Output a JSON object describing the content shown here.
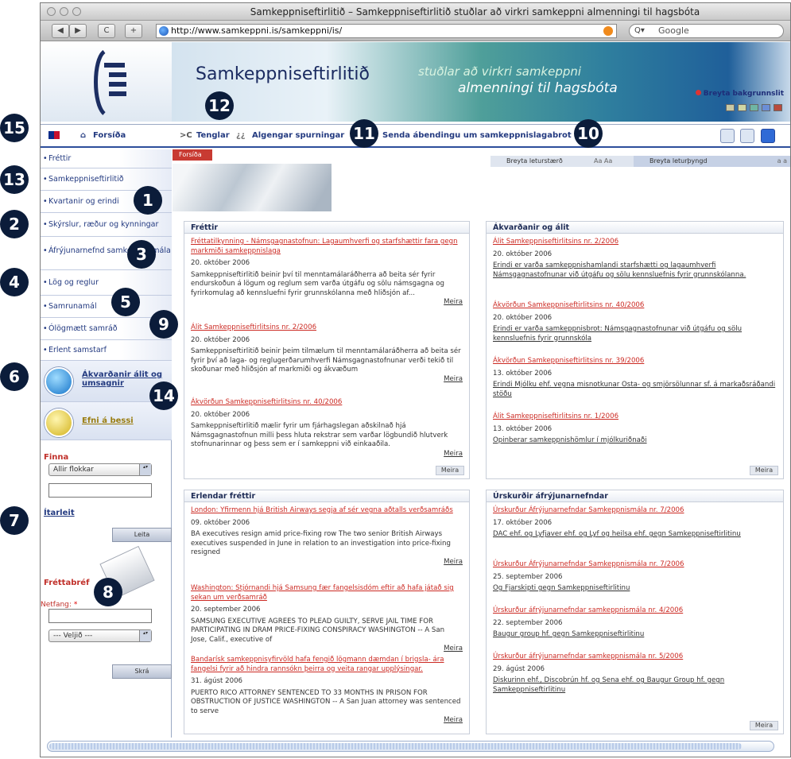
{
  "window": {
    "title": "Samkeppniseftirlitið – Samkeppniseftirlitið stuðlar að virkri samkeppni almenningi til hagsbóta"
  },
  "toolbar": {
    "back": "◀",
    "forward": "▶",
    "reload": "C",
    "add": "+",
    "url": "http://www.samkeppni.is/samkeppni/is/",
    "search_placeholder": "Google",
    "search_prefix": "Q▾"
  },
  "header": {
    "site_name": "Samkeppniseftirlitið",
    "tagline_1": "stuðlar að virkri samkeppni",
    "tagline_2": "almenningi til hagsbóta",
    "bg_change": "Breyta bakgrunnslit",
    "swatch_colors": [
      "#c9c9a4",
      "#cfd6a4",
      "#6fb5a3",
      "#6b8ed6",
      "#b94a3c"
    ]
  },
  "nav": {
    "home": "Forsíða",
    "links": "Tenglar",
    "faq": "Algengar spurningar",
    "report": "Senda ábendingu um samkeppnislagabrot"
  },
  "sidebar": {
    "items": [
      "Fréttir",
      "Samkeppniseftirlitið",
      "Kvartanir og erindi",
      "Skýrslur, ræður og kynningar",
      "Áfrýjunarnefnd samkeppnismála",
      "Lög og reglur",
      "Samrunamál",
      "Ólögmætt samráð",
      "Erlent samstarf"
    ],
    "promo_1": "Ákvarðanir álit og umsagnir",
    "promo_2": "Efni á bessi",
    "search_label": "Finna",
    "search_select": "Allir flokkar",
    "advanced": "Ítarleit",
    "search_button": "Leita",
    "newsletter_label": "Fréttabréf",
    "email_label": "Netfang:",
    "email_required": "*",
    "newsletter_select": "--- Veljið ---",
    "send_button": "Skrá"
  },
  "main": {
    "breadcrumb": "Forsíða",
    "ctrl_1": "Breyta leturstærð",
    "ctrl_1b": "Aa Aa",
    "ctrl_2": "Breyta leturþyngd",
    "ctrl_2b": "a a",
    "news": {
      "heading": "Fréttir",
      "entries": [
        {
          "title": "Fréttatilkynning - Námsgagnastofnun: Lagaumhverfi og starfshættir fara gegn markmiði samkeppnislaga",
          "date": "20. október 2006",
          "text": "Samkeppniseftirlitið beinir því til menntamálaráðherra að beita sér fyrir endurskoðun á lögum og reglum sem varða útgáfu og sölu námsgagna og fyrirkomulag að kennsluefni fyrir grunnskólanna með hliðsjón af...",
          "more": "Meira"
        },
        {
          "title": "Álit Samkeppniseftirlitsins nr. 2/2006",
          "date": "20. október 2006",
          "text": "Samkeppniseftirlitið beinir þeim tilmælum til menntamálaráðherra að beita sér fyrir því að laga- og reglugerðarumhverfi Námsgagnastofnunar verði tekið til skoðunar með hliðsjón af markmiði og ákvæðum",
          "more": "Meira"
        },
        {
          "title": "Ákvörðun Samkeppniseftirlitsins nr. 40/2006",
          "date": "20. október 2006",
          "text": "Samkeppniseftirlitið mælir fyrir um fjárhagslegan aðskilnað hjá Námsgagnastofnun milli þess hluta rekstrar sem varðar lögbundið hlutverk stofnunarinnar og þess sem er í samkeppni við einkaaðila.",
          "more": "Meira"
        }
      ],
      "box_more": "Meira"
    },
    "decisions": {
      "heading": "Ákvarðanir og álit",
      "entries": [
        {
          "title": "Álit Samkeppniseftirlitsins nr. 2/2006",
          "date": "20. október 2006",
          "link": "Erindi er varða samkeppnishamlandi starfshætti og lagaumhverfi Námsgagnastofnunar við útgáfu og sölu kennsluefnis fyrir grunnskólanna."
        },
        {
          "title": "Ákvörðun Samkeppniseftirlitsins nr. 40/2006",
          "date": "20. október 2006",
          "link": "Erindi er varða samkeppnisbrot: Námsgagnastofnunar við útgáfu og sölu kennsluefnis fyrir grunnskóla"
        },
        {
          "title": "Ákvörðun Samkeppniseftirlitsins nr. 39/2006",
          "date": "13. október 2006",
          "link": "Erindi Mjólku ehf. vegna misnotkunar Osta- og smjörsölunnar sf. á markaðsráðandi stöðu"
        },
        {
          "title": "Álit Samkeppniseftirlitsins nr. 1/2006",
          "date": "13. október 2006",
          "link": "Opinberar samkeppnishömlur í mjólkuriðnaði"
        }
      ],
      "box_more": "Meira"
    },
    "foreign": {
      "heading": "Erlendar fréttir",
      "entries": [
        {
          "title": "London: Yfirmenn hjá British Airways segja af sér vegna aðtalls verðsamráðs",
          "date": "09. október 2006",
          "text": "BA executives resign amid price-fixing row The two senior British Airways executives suspended in June in relation to an investigation into price-fixing resigned",
          "more": "Meira"
        },
        {
          "title": "Washington: Stjórnandi hjá Samsung fær fangelsisdóm eftir að hafa játað sig sekan um verðsamráð",
          "date": "20. september 2006",
          "text": "SAMSUNG EXECUTIVE AGREES TO PLEAD GUILTY, SERVE JAIL TIME FOR PARTICIPATING IN DRAM PRICE-FIXING CONSPIRACY WASHINGTON -- A San Jose, Calif., executive of",
          "more": "Meira"
        },
        {
          "title": "Bandarísk samkeppnisyfirvöld hafa fengið lögmann dæmdan í brigsla- ára fangelsi fyrir að hindra rannsókn þeirra og veita rangar upplýsingar.",
          "date": "31. ágúst 2006",
          "text": "PUERTO RICO ATTORNEY SENTENCED TO 33 MONTHS IN PRISON FOR OBSTRUCTION OF JUSTICE WASHINGTON -- A San Juan attorney was sentenced to serve",
          "more": "Meira"
        }
      ],
      "box_more": "Meira"
    },
    "rulings": {
      "heading": "Úrskurðir áfrýjunarnefndar",
      "entries": [
        {
          "title": "Úrskurður Áfrýjunarnefndar Samkeppnismála nr. 7/2006",
          "date": "17. október 2006",
          "link": "DAC ehf. og Lyfjaver ehf. og Lyf og heilsa ehf. gegn Samkeppniseftirlitinu"
        },
        {
          "title": "Úrskurður Áfrýjunarnefndar Samkeppnismála nr. 7/2006",
          "date": "25. september 2006",
          "link": "Og Fjarskipti gegn Samkeppniseftirlitinu"
        },
        {
          "title": "Úrskurður áfrýjunarnefndar samkeppnismála nr. 4/2006",
          "date": "22. september 2006",
          "link": "Baugur group hf. gegn Samkeppniseftirlitinu"
        },
        {
          "title": "Úrskurður áfrýjunarnefndar samkeppnismála nr. 5/2006",
          "date": "29. ágúst 2006",
          "link": "Diskurinn ehf., Discobrún hf. og Sena ehf. og Baugur Group hf. gegn Samkeppniseftirlitinu"
        }
      ],
      "box_more": "Meira"
    }
  },
  "badges": [
    "1",
    "2",
    "3",
    "4",
    "5",
    "6",
    "7",
    "8",
    "9",
    "10",
    "11",
    "12",
    "13",
    "14",
    "15"
  ]
}
